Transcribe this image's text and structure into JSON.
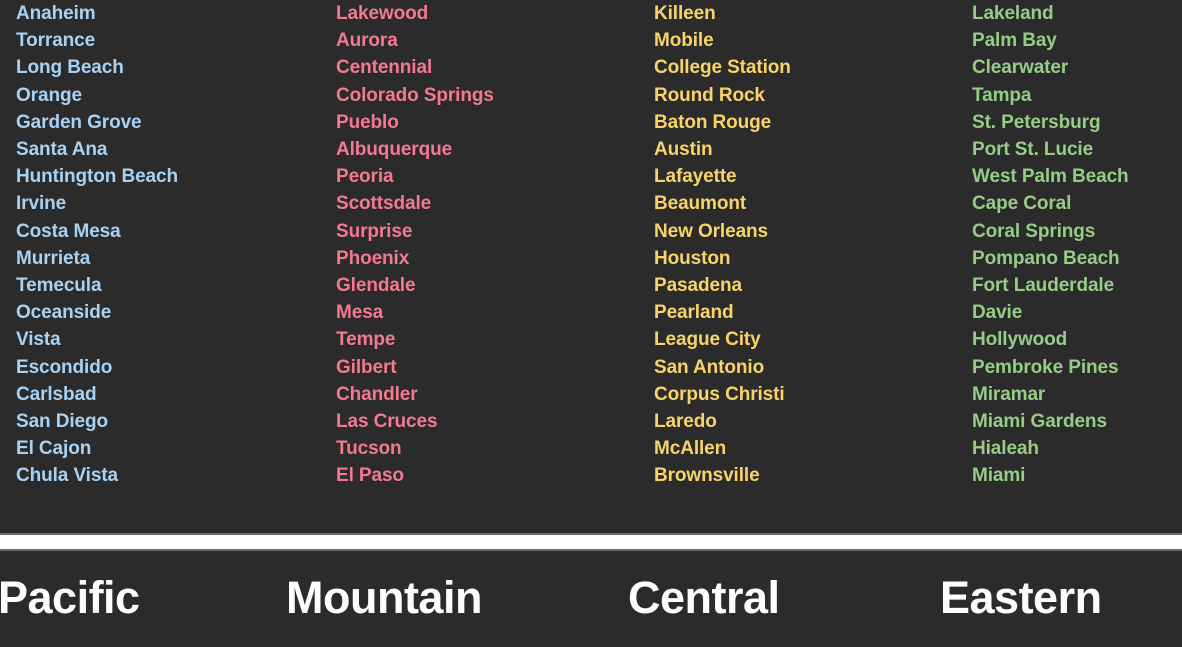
{
  "page": {
    "background_color": "#2b2b2b",
    "separator_color": "#ffffff",
    "label_color": "#fdfdfd"
  },
  "zones": [
    {
      "label": "Pacific",
      "color": "#a9d1f2",
      "cities": [
        "Anaheim",
        "Torrance",
        "Long Beach",
        "Orange",
        "Garden Grove",
        "Santa Ana",
        "Huntington Beach",
        "Irvine",
        "Costa Mesa",
        "Murrieta",
        "Temecula",
        "Oceanside",
        "Vista",
        "Escondido",
        "Carlsbad",
        "San Diego",
        "El Cajon",
        "Chula Vista"
      ]
    },
    {
      "label": "Mountain",
      "color": "#f4798f",
      "cities": [
        "Lakewood",
        "Aurora",
        "Centennial",
        "Colorado Springs",
        "Pueblo",
        "Albuquerque",
        "Peoria",
        "Scottsdale",
        "Surprise",
        "Phoenix",
        "Glendale",
        "Mesa",
        "Tempe",
        "Gilbert",
        "Chandler",
        "Las Cruces",
        "Tucson",
        "El Paso"
      ]
    },
    {
      "label": "Central",
      "color": "#f7d46a",
      "cities": [
        "Killeen",
        "Mobile",
        "College Station",
        "Round Rock",
        "Baton Rouge",
        "Austin",
        "Lafayette",
        "Beaumont",
        "New Orleans",
        "Houston",
        "Pasadena",
        "Pearland",
        "League City",
        "San Antonio",
        "Corpus Christi",
        "Laredo",
        "McAllen",
        "Brownsville"
      ]
    },
    {
      "label": "Eastern",
      "color": "#97cc87",
      "cities": [
        "Lakeland",
        "Palm Bay",
        "Clearwater",
        "Tampa",
        "St. Petersburg",
        "Port St. Lucie",
        "West Palm Beach",
        "Cape Coral",
        "Coral Springs",
        "Pompano Beach",
        "Fort Lauderdale",
        "Davie",
        "Hollywood",
        "Pembroke Pines",
        "Miramar",
        "Miami Gardens",
        "Hialeah",
        "Miami"
      ]
    }
  ]
}
